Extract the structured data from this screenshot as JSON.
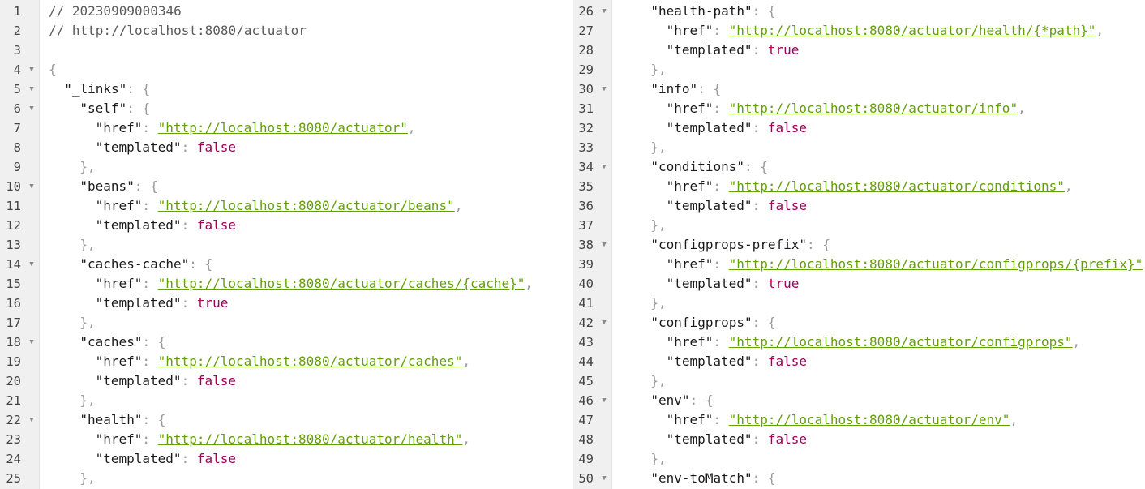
{
  "left": [
    {
      "n": "1",
      "i": 0,
      "t": "comment",
      "text": "// 20230909000346"
    },
    {
      "n": "2",
      "i": 0,
      "t": "comment",
      "text": "// http://localhost:8080/actuator"
    },
    {
      "n": "3",
      "i": 0,
      "t": "blank"
    },
    {
      "n": "4",
      "i": 0,
      "t": "open",
      "fold": true
    },
    {
      "n": "5",
      "i": 1,
      "t": "obj",
      "fold": true,
      "key": "_links"
    },
    {
      "n": "6",
      "i": 2,
      "t": "obj",
      "fold": true,
      "key": "self"
    },
    {
      "n": "7",
      "i": 3,
      "t": "href",
      "key": "href",
      "value": "http://localhost:8080/actuator",
      "comma": true
    },
    {
      "n": "8",
      "i": 3,
      "t": "bool",
      "key": "templated",
      "value": "false"
    },
    {
      "n": "9",
      "i": 2,
      "t": "close"
    },
    {
      "n": "10",
      "i": 2,
      "t": "obj",
      "fold": true,
      "key": "beans"
    },
    {
      "n": "11",
      "i": 3,
      "t": "href",
      "key": "href",
      "value": "http://localhost:8080/actuator/beans",
      "comma": true
    },
    {
      "n": "12",
      "i": 3,
      "t": "bool",
      "key": "templated",
      "value": "false"
    },
    {
      "n": "13",
      "i": 2,
      "t": "close"
    },
    {
      "n": "14",
      "i": 2,
      "t": "obj",
      "fold": true,
      "key": "caches-cache"
    },
    {
      "n": "15",
      "i": 3,
      "t": "href",
      "key": "href",
      "value": "http://localhost:8080/actuator/caches/{cache}",
      "comma": true
    },
    {
      "n": "16",
      "i": 3,
      "t": "bool",
      "key": "templated",
      "value": "true"
    },
    {
      "n": "17",
      "i": 2,
      "t": "close"
    },
    {
      "n": "18",
      "i": 2,
      "t": "obj",
      "fold": true,
      "key": "caches"
    },
    {
      "n": "19",
      "i": 3,
      "t": "href",
      "key": "href",
      "value": "http://localhost:8080/actuator/caches",
      "comma": true
    },
    {
      "n": "20",
      "i": 3,
      "t": "bool",
      "key": "templated",
      "value": "false"
    },
    {
      "n": "21",
      "i": 2,
      "t": "close"
    },
    {
      "n": "22",
      "i": 2,
      "t": "obj",
      "fold": true,
      "key": "health"
    },
    {
      "n": "23",
      "i": 3,
      "t": "href",
      "key": "href",
      "value": "http://localhost:8080/actuator/health",
      "comma": true
    },
    {
      "n": "24",
      "i": 3,
      "t": "bool",
      "key": "templated",
      "value": "false"
    },
    {
      "n": "25",
      "i": 2,
      "t": "close"
    }
  ],
  "right": [
    {
      "n": "26",
      "i": 2,
      "t": "obj",
      "fold": true,
      "key": "health-path"
    },
    {
      "n": "27",
      "i": 3,
      "t": "href",
      "key": "href",
      "value": "http://localhost:8080/actuator/health/{*path}",
      "comma": true
    },
    {
      "n": "28",
      "i": 3,
      "t": "bool",
      "key": "templated",
      "value": "true"
    },
    {
      "n": "29",
      "i": 2,
      "t": "close"
    },
    {
      "n": "30",
      "i": 2,
      "t": "obj",
      "fold": true,
      "key": "info"
    },
    {
      "n": "31",
      "i": 3,
      "t": "href",
      "key": "href",
      "value": "http://localhost:8080/actuator/info",
      "comma": true
    },
    {
      "n": "32",
      "i": 3,
      "t": "bool",
      "key": "templated",
      "value": "false"
    },
    {
      "n": "33",
      "i": 2,
      "t": "close"
    },
    {
      "n": "34",
      "i": 2,
      "t": "obj",
      "fold": true,
      "key": "conditions"
    },
    {
      "n": "35",
      "i": 3,
      "t": "href",
      "key": "href",
      "value": "http://localhost:8080/actuator/conditions",
      "comma": true
    },
    {
      "n": "36",
      "i": 3,
      "t": "bool",
      "key": "templated",
      "value": "false"
    },
    {
      "n": "37",
      "i": 2,
      "t": "close"
    },
    {
      "n": "38",
      "i": 2,
      "t": "obj",
      "fold": true,
      "key": "configprops-prefix"
    },
    {
      "n": "39",
      "i": 3,
      "t": "href",
      "key": "href",
      "value": "http://localhost:8080/actuator/configprops/{prefix}",
      "comma": true
    },
    {
      "n": "40",
      "i": 3,
      "t": "bool",
      "key": "templated",
      "value": "true"
    },
    {
      "n": "41",
      "i": 2,
      "t": "close"
    },
    {
      "n": "42",
      "i": 2,
      "t": "obj",
      "fold": true,
      "key": "configprops"
    },
    {
      "n": "43",
      "i": 3,
      "t": "href",
      "key": "href",
      "value": "http://localhost:8080/actuator/configprops",
      "comma": true
    },
    {
      "n": "44",
      "i": 3,
      "t": "bool",
      "key": "templated",
      "value": "false"
    },
    {
      "n": "45",
      "i": 2,
      "t": "close"
    },
    {
      "n": "46",
      "i": 2,
      "t": "obj",
      "fold": true,
      "key": "env"
    },
    {
      "n": "47",
      "i": 3,
      "t": "href",
      "key": "href",
      "value": "http://localhost:8080/actuator/env",
      "comma": true
    },
    {
      "n": "48",
      "i": 3,
      "t": "bool",
      "key": "templated",
      "value": "false"
    },
    {
      "n": "49",
      "i": 2,
      "t": "close"
    },
    {
      "n": "50",
      "i": 2,
      "t": "obj",
      "fold": true,
      "key": "env-toMatch"
    }
  ],
  "glyphs": {
    "fold": "▼",
    "open_brace": "{",
    "close_brace": "},",
    "colon": ": ",
    "comma": ",",
    "quote": "\""
  },
  "colors": {
    "url": "#64a00a",
    "boolean": "#a0005a",
    "punctuation": "#9a9a9a",
    "comment": "#5a5a5a",
    "gutter": "#f0f0f0"
  }
}
